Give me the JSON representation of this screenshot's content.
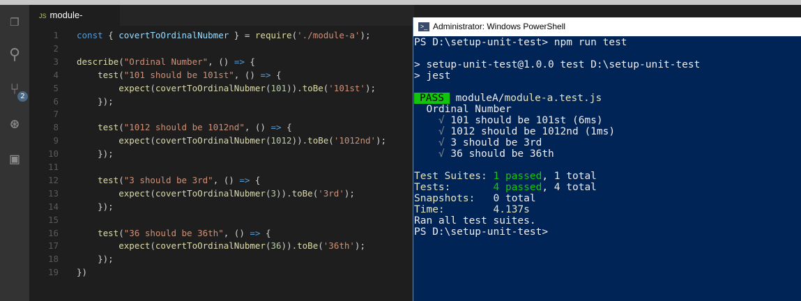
{
  "editor": {
    "tab": {
      "icon": "JS",
      "filename": "module-a.test.js",
      "close": "×"
    },
    "activity_bar": {
      "items": [
        "explorer",
        "search",
        "source-control",
        "debug",
        "extensions"
      ],
      "scm_badge": "2"
    },
    "lines": [
      [
        [
          "const",
          "kw"
        ],
        [
          " { ",
          ""
        ],
        [
          "covertToOrdinalNubmer",
          "id"
        ],
        [
          " } = ",
          ""
        ],
        [
          "require",
          "fn"
        ],
        [
          "(",
          ""
        ],
        [
          "'./module-a'",
          "str"
        ],
        [
          ");",
          ""
        ]
      ],
      [],
      [
        [
          "describe",
          "fn"
        ],
        [
          "(",
          ""
        ],
        [
          "\"Ordinal Number\"",
          "str"
        ],
        [
          ", () ",
          ""
        ],
        [
          "=>",
          "kw"
        ],
        [
          " {",
          ""
        ]
      ],
      [
        [
          "    ",
          ""
        ],
        [
          "test",
          "fn"
        ],
        [
          "(",
          ""
        ],
        [
          "\"101 should be 101st\"",
          "str"
        ],
        [
          ", () ",
          ""
        ],
        [
          "=>",
          "kw"
        ],
        [
          " {",
          ""
        ]
      ],
      [
        [
          "        ",
          ""
        ],
        [
          "expect",
          "fn"
        ],
        [
          "(",
          ""
        ],
        [
          "covertToOrdinalNubmer",
          "fn"
        ],
        [
          "(",
          ""
        ],
        [
          "101",
          "num"
        ],
        [
          ")).",
          ""
        ],
        [
          "toBe",
          "fn"
        ],
        [
          "(",
          ""
        ],
        [
          "'101st'",
          "str"
        ],
        [
          ");",
          ""
        ]
      ],
      [
        [
          "    });",
          ""
        ]
      ],
      [],
      [
        [
          "    ",
          ""
        ],
        [
          "test",
          "fn"
        ],
        [
          "(",
          ""
        ],
        [
          "\"1012 should be 1012nd\"",
          "str"
        ],
        [
          ", () ",
          ""
        ],
        [
          "=>",
          "kw"
        ],
        [
          " {",
          ""
        ]
      ],
      [
        [
          "        ",
          ""
        ],
        [
          "expect",
          "fn"
        ],
        [
          "(",
          ""
        ],
        [
          "covertToOrdinalNubmer",
          "fn"
        ],
        [
          "(",
          ""
        ],
        [
          "1012",
          "num"
        ],
        [
          ")).",
          ""
        ],
        [
          "toBe",
          "fn"
        ],
        [
          "(",
          ""
        ],
        [
          "'1012nd'",
          "str"
        ],
        [
          ");",
          ""
        ]
      ],
      [
        [
          "    });",
          ""
        ]
      ],
      [],
      [
        [
          "    ",
          ""
        ],
        [
          "test",
          "fn"
        ],
        [
          "(",
          ""
        ],
        [
          "\"3 should be 3rd\"",
          "str"
        ],
        [
          ", () ",
          ""
        ],
        [
          "=>",
          "kw"
        ],
        [
          " {",
          ""
        ]
      ],
      [
        [
          "        ",
          ""
        ],
        [
          "expect",
          "fn"
        ],
        [
          "(",
          ""
        ],
        [
          "covertToOrdinalNubmer",
          "fn"
        ],
        [
          "(",
          ""
        ],
        [
          "3",
          "num"
        ],
        [
          ")).",
          ""
        ],
        [
          "toBe",
          "fn"
        ],
        [
          "(",
          ""
        ],
        [
          "'3rd'",
          "str"
        ],
        [
          ");",
          ""
        ]
      ],
      [
        [
          "    });",
          ""
        ]
      ],
      [],
      [
        [
          "    ",
          ""
        ],
        [
          "test",
          "fn"
        ],
        [
          "(",
          ""
        ],
        [
          "\"36 should be 36th\"",
          "str"
        ],
        [
          ", () ",
          ""
        ],
        [
          "=>",
          "kw"
        ],
        [
          " {",
          ""
        ]
      ],
      [
        [
          "        ",
          ""
        ],
        [
          "expect",
          "fn"
        ],
        [
          "(",
          ""
        ],
        [
          "covertToOrdinalNubmer",
          "fn"
        ],
        [
          "(",
          ""
        ],
        [
          "36",
          "num"
        ],
        [
          ")).",
          ""
        ],
        [
          "toBe",
          "fn"
        ],
        [
          "(",
          ""
        ],
        [
          "'36th'",
          "str"
        ],
        [
          ");",
          ""
        ]
      ],
      [
        [
          "    });",
          ""
        ]
      ],
      [
        [
          "})",
          ""
        ]
      ]
    ]
  },
  "terminal": {
    "title": "Administrator: Windows PowerShell",
    "lines": [
      [
        [
          "PS D:\\setup-unit-test> npm run test",
          ""
        ]
      ],
      [],
      [
        [
          "> setup-unit-test@1.0.0 test D:\\setup-unit-test",
          ""
        ]
      ],
      [
        [
          "> jest",
          ""
        ]
      ],
      [],
      [
        [
          "PASS",
          "pass"
        ],
        [
          " moduleA/",
          ""
        ],
        [
          "module-a.test.js",
          "yel"
        ]
      ],
      [
        [
          "  Ordinal Number",
          ""
        ]
      ],
      [
        [
          "    ",
          ""
        ],
        [
          "√",
          "dim"
        ],
        [
          " 101 should be 101st (6ms)",
          ""
        ]
      ],
      [
        [
          "    ",
          ""
        ],
        [
          "√",
          "dim"
        ],
        [
          " 1012 should be 1012nd (1ms)",
          ""
        ]
      ],
      [
        [
          "    ",
          ""
        ],
        [
          "√",
          "dim"
        ],
        [
          " 3 should be 3rd",
          ""
        ]
      ],
      [
        [
          "    ",
          ""
        ],
        [
          "√",
          "dim"
        ],
        [
          " 36 should be 36th",
          ""
        ]
      ],
      [],
      [
        [
          "Test Suites: ",
          "yel"
        ],
        [
          "1 passed",
          "green"
        ],
        [
          ", 1 total",
          ""
        ]
      ],
      [
        [
          "Tests:       ",
          "yel"
        ],
        [
          "4 passed",
          "green"
        ],
        [
          ", 4 total",
          ""
        ]
      ],
      [
        [
          "Snapshots:   ",
          "yel"
        ],
        [
          "0 total",
          ""
        ]
      ],
      [
        [
          "Time:        ",
          "yel"
        ],
        [
          "4.137s",
          "yel"
        ]
      ],
      [
        [
          "Ran all test suites.",
          ""
        ]
      ],
      [
        [
          "PS D:\\setup-unit-test>",
          ""
        ]
      ]
    ]
  },
  "colors": {
    "editor_bg": "#1e1e1e",
    "console_bg": "#012456",
    "pass_bg": "#13c40f"
  }
}
